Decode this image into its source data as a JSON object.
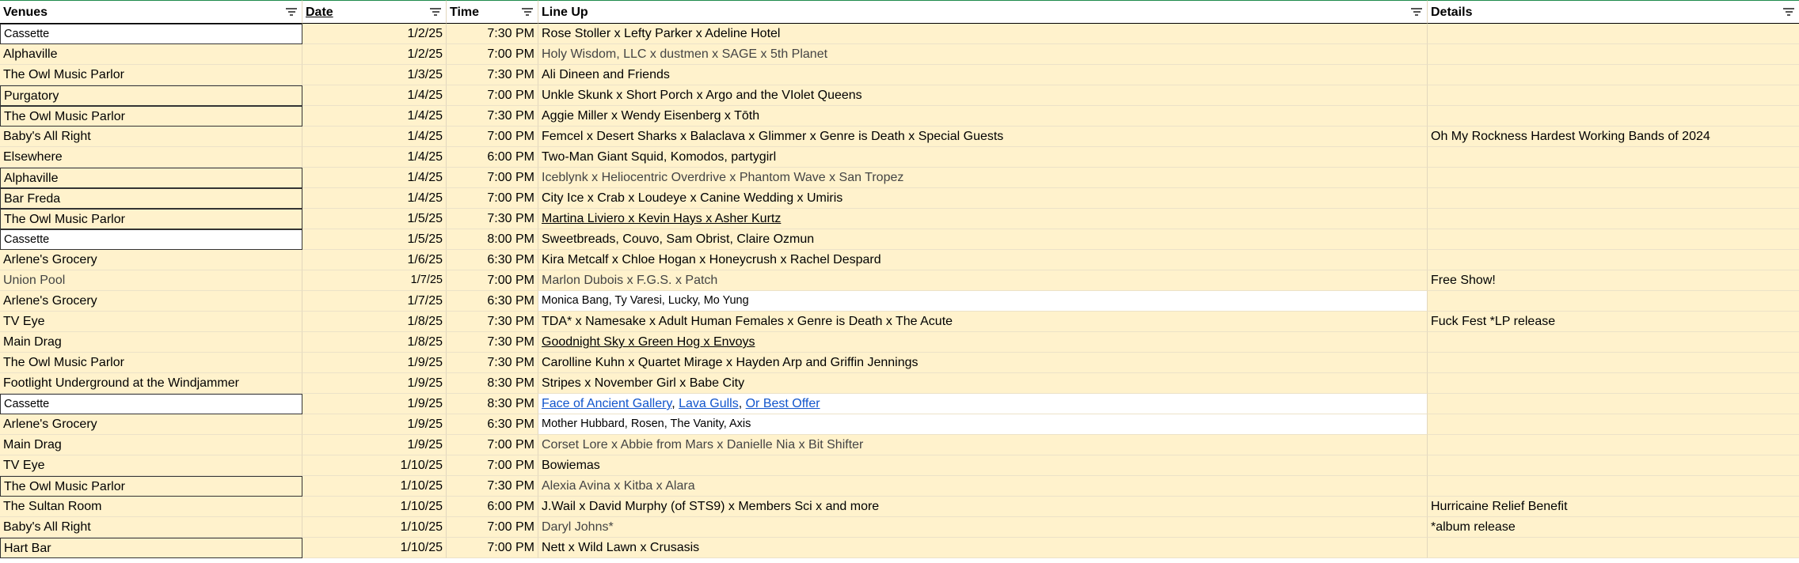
{
  "headers": {
    "venues": "Venues",
    "date": "Date",
    "time": "Time",
    "lineup": "Line Up",
    "details": "Details"
  },
  "rows": [
    {
      "venue": "Cassette",
      "date": "1/2/25",
      "time": "7:30 PM",
      "lineup": "Rose Stoller x Lefty Parker x Adeline Hotel",
      "details": ""
    },
    {
      "venue": "Alphaville",
      "date": "1/2/25",
      "time": "7:00 PM",
      "lineup": "Holy Wisdom, LLC x dustmen x SAGE x 5th Planet",
      "details": ""
    },
    {
      "venue": "The Owl Music Parlor",
      "date": "1/3/25",
      "time": "7:30 PM",
      "lineup": "Ali Dineen and Friends",
      "details": ""
    },
    {
      "venue": "Purgatory",
      "date": "1/4/25",
      "time": "7:00 PM",
      "lineup": "Unkle Skunk x Short Porch x Argo and the VIolet Queens",
      "details": ""
    },
    {
      "venue": "The Owl Music Parlor",
      "date": "1/4/25",
      "time": "7:30 PM",
      "lineup": "Aggie Miller x Wendy Eisenberg x Tōth",
      "details": ""
    },
    {
      "venue": "Baby's All Right",
      "date": "1/4/25",
      "time": "7:00 PM",
      "lineup": "Femcel x Desert Sharks x Balaclava x Glimmer x Genre is Death x Special Guests",
      "details": "Oh My Rockness Hardest Working Bands of 2024"
    },
    {
      "venue": "Elsewhere",
      "date": "1/4/25",
      "time": "6:00 PM",
      "lineup": "Two-Man Giant Squid, Komodos, partygirl",
      "details": ""
    },
    {
      "venue": "Alphaville",
      "date": "1/4/25",
      "time": "7:00 PM",
      "lineup": "Iceblynk x Heliocentric Overdrive x Phantom Wave x San Tropez",
      "details": ""
    },
    {
      "venue": "Bar Freda",
      "date": "1/4/25",
      "time": "7:00 PM",
      "lineup": "City Ice x Crab x Loudeye x Canine Wedding x Umiris",
      "details": ""
    },
    {
      "venue": "The Owl Music Parlor",
      "date": "1/5/25",
      "time": "7:30 PM",
      "lineup": "Martina Liviero x Kevin Hays x Asher Kurtz",
      "details": ""
    },
    {
      "venue": "Cassette",
      "date": "1/5/25",
      "time": "8:00 PM",
      "lineup": "Sweetbreads, Couvo, Sam Obrist, Claire Ozmun",
      "details": ""
    },
    {
      "venue": "Arlene's Grocery",
      "date": "1/6/25",
      "time": "6:30 PM",
      "lineup": "Kira Metcalf x Chloe Hogan x Honeycrush x Rachel Despard",
      "details": ""
    },
    {
      "venue": "Union Pool",
      "date": "1/7/25",
      "time": "7:00 PM",
      "lineup": "Marlon Dubois x F.G.S. x Patch",
      "details": "Free Show!"
    },
    {
      "venue": "Arlene's Grocery",
      "date": "1/7/25",
      "time": "6:30 PM",
      "lineup": "Monica Bang, Ty Varesi, Lucky, Mo Yung",
      "details": ""
    },
    {
      "venue": "TV Eye",
      "date": "1/8/25",
      "time": "7:30 PM",
      "lineup": "TDA* x Namesake x Adult Human Females x Genre is Death x The Acute",
      "details": "Fuck Fest  *LP release"
    },
    {
      "venue": "Main Drag",
      "date": "1/8/25",
      "time": "7:30 PM",
      "lineup": "Goodnight Sky x Green Hog x Envoys",
      "details": ""
    },
    {
      "venue": "The Owl Music Parlor",
      "date": "1/9/25",
      "time": "7:30 PM",
      "lineup": "Carolline Kuhn x Quartet Mirage x Hayden Arp and Griffin Jennings",
      "details": ""
    },
    {
      "venue": "Footlight Underground at the Windjammer",
      "date": "1/9/25",
      "time": "8:30 PM",
      "lineup": "Stripes x November Girl x Babe City",
      "details": ""
    },
    {
      "venue": "Cassette",
      "date": "1/9/25",
      "time": "8:30 PM",
      "lineup": "",
      "lineup_links": [
        "Face of Ancient Gallery",
        "Lava Gulls",
        "Or Best Offer"
      ],
      "lineup_sep": ", ",
      "details": ""
    },
    {
      "venue": "Arlene's Grocery",
      "date": "1/9/25",
      "time": "6:30 PM",
      "lineup": "Mother Hubbard, Rosen, The Vanity, Axis",
      "details": ""
    },
    {
      "venue": "Main Drag",
      "date": "1/9/25",
      "time": "7:00 PM",
      "lineup": "Corset Lore x Abbie from Mars x Danielle Nia x Bit Shifter",
      "details": ""
    },
    {
      "venue": "TV Eye",
      "date": "1/10/25",
      "time": "7:00 PM",
      "lineup": "Bowiemas",
      "details": ""
    },
    {
      "venue": "The Owl Music Parlor",
      "date": "1/10/25",
      "time": "7:30 PM",
      "lineup": "Alexia Avina x Kitba x Alara",
      "details": ""
    },
    {
      "venue": "The Sultan Room",
      "date": "1/10/25",
      "time": "6:00 PM",
      "lineup": "J.Wail x David Murphy (of STS9) x Members Sci x and more",
      "details": "Hurricaine Relief Benefit"
    },
    {
      "venue": "Baby's All Right",
      "date": "1/10/25",
      "time": "7:00 PM",
      "lineup": "Daryl Johns*",
      "details": "*album release"
    },
    {
      "venue": "Hart Bar",
      "date": "1/10/25",
      "time": "7:00 PM",
      "lineup": "Nett x Wild Lawn x Crusasis",
      "details": ""
    }
  ]
}
